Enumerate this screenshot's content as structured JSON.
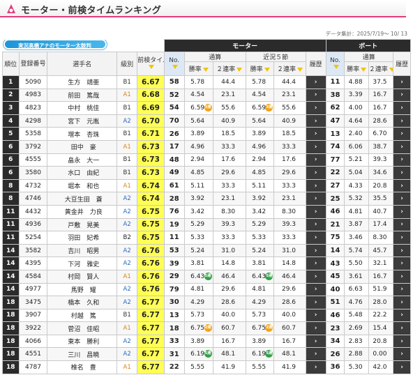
{
  "header": {
    "title": "モーター・前検タイムランキング",
    "logo_icon": "boat-race-logo-icon"
  },
  "period": "データ集計：2025/7/19～ 10/ 13",
  "banner": {
    "text": "実況高橋アナのモーター太鼓判"
  },
  "columns": {
    "rank": "順位",
    "reg": "登録番号",
    "name": "選手名",
    "class": "級別",
    "time": "前検タイム",
    "motor_group": "モーター",
    "boat_group": "ボート",
    "no": "No.",
    "overall": "通算",
    "recent": "近況５節",
    "win": "勝率",
    "rate2": "２連率",
    "history": "履歴"
  },
  "rows": [
    {
      "rank": "1",
      "reg": "5090",
      "name": "生方　靖亜",
      "cls": "B1",
      "time": "6.67",
      "m_no": "58",
      "m_win": "5.78",
      "m_r2": "44.4",
      "m_rw": "5.78",
      "m_rr2": "44.4",
      "b_no": "11",
      "b_win": "4.88",
      "b_r2": "37.5"
    },
    {
      "rank": "2",
      "reg": "4983",
      "name": "前田　篤哉",
      "cls": "A1",
      "time": "6.68",
      "m_no": "52",
      "m_win": "4.54",
      "m_r2": "23.1",
      "m_rw": "4.54",
      "m_rr2": "23.1",
      "b_no": "38",
      "b_win": "3.39",
      "b_r2": "16.7"
    },
    {
      "rank": "3",
      "reg": "4823",
      "name": "中村　桃佳",
      "cls": "B1",
      "time": "6.69",
      "m_no": "54",
      "m_win": "6.59",
      "m_r2": "55.6",
      "m_rw": "6.59",
      "m_rr2": "55.6",
      "b_no": "62",
      "b_win": "4.00",
      "b_r2": "16.7",
      "badge": "3d"
    },
    {
      "rank": "4",
      "reg": "4298",
      "name": "宮下　元胤",
      "cls": "A2",
      "time": "6.70",
      "m_no": "70",
      "m_win": "5.64",
      "m_r2": "40.9",
      "m_rw": "5.64",
      "m_rr2": "40.9",
      "b_no": "47",
      "b_win": "4.64",
      "b_r2": "28.6"
    },
    {
      "rank": "5",
      "reg": "5358",
      "name": "増本　杏珠",
      "cls": "B1",
      "time": "6.71",
      "m_no": "26",
      "m_win": "3.89",
      "m_r2": "18.5",
      "m_rw": "3.89",
      "m_rr2": "18.5",
      "b_no": "13",
      "b_win": "2.40",
      "b_r2": "6.70"
    },
    {
      "rank": "6",
      "reg": "3792",
      "name": "田中　豪",
      "cls": "A1",
      "time": "6.73",
      "m_no": "17",
      "m_win": "4.96",
      "m_r2": "33.3",
      "m_rw": "4.96",
      "m_rr2": "33.3",
      "b_no": "74",
      "b_win": "6.06",
      "b_r2": "38.7"
    },
    {
      "rank": "6",
      "reg": "4555",
      "name": "畠永　大一",
      "cls": "B1",
      "time": "6.73",
      "m_no": "48",
      "m_win": "2.94",
      "m_r2": "17.6",
      "m_rw": "2.94",
      "m_rr2": "17.6",
      "b_no": "77",
      "b_win": "5.21",
      "b_r2": "39.3"
    },
    {
      "rank": "6",
      "reg": "3580",
      "name": "水口　由紀",
      "cls": "B1",
      "time": "6.73",
      "m_no": "49",
      "m_win": "4.85",
      "m_r2": "29.6",
      "m_rw": "4.85",
      "m_rr2": "29.6",
      "b_no": "22",
      "b_win": "5.04",
      "b_r2": "34.6"
    },
    {
      "rank": "8",
      "reg": "4732",
      "name": "堀本　和也",
      "cls": "A1",
      "time": "6.74",
      "m_no": "61",
      "m_win": "5.11",
      "m_r2": "33.3",
      "m_rw": "5.11",
      "m_rr2": "33.3",
      "b_no": "27",
      "b_win": "4.33",
      "b_r2": "20.8"
    },
    {
      "rank": "8",
      "reg": "4746",
      "name": "大豆生田　蒼",
      "cls": "A2",
      "time": "6.74",
      "m_no": "28",
      "m_win": "3.92",
      "m_r2": "23.1",
      "m_rw": "3.92",
      "m_rr2": "23.1",
      "b_no": "25",
      "b_win": "5.32",
      "b_r2": "35.5"
    },
    {
      "rank": "11",
      "reg": "4432",
      "name": "黄金井　力良",
      "cls": "A2",
      "time": "6.75",
      "m_no": "76",
      "m_win": "3.42",
      "m_r2": "8.30",
      "m_rw": "3.42",
      "m_rr2": "8.30",
      "b_no": "46",
      "b_win": "4.81",
      "b_r2": "40.7"
    },
    {
      "rank": "11",
      "reg": "4936",
      "name": "戸敷　晃美",
      "cls": "A2",
      "time": "6.75",
      "m_no": "19",
      "m_win": "5.29",
      "m_r2": "39.3",
      "m_rw": "5.29",
      "m_rr2": "39.3",
      "b_no": "21",
      "b_win": "3.87",
      "b_r2": "17.4"
    },
    {
      "rank": "11",
      "reg": "5254",
      "name": "羽田　妃希",
      "cls": "B2",
      "time": "6.75",
      "m_no": "11",
      "m_win": "5.33",
      "m_r2": "33.3",
      "m_rw": "5.33",
      "m_rr2": "33.3",
      "b_no": "75",
      "b_win": "3.46",
      "b_r2": "8.30"
    },
    {
      "rank": "14",
      "reg": "3582",
      "name": "吉川　昭男",
      "cls": "A2",
      "time": "6.76",
      "m_no": "53",
      "m_win": "5.24",
      "m_r2": "31.0",
      "m_rw": "5.24",
      "m_rr2": "31.0",
      "b_no": "14",
      "b_win": "5.74",
      "b_r2": "45.7"
    },
    {
      "rank": "14",
      "reg": "4395",
      "name": "下河　雅史",
      "cls": "A2",
      "time": "6.76",
      "m_no": "39",
      "m_win": "3.81",
      "m_r2": "14.8",
      "m_rw": "3.81",
      "m_rr2": "14.8",
      "b_no": "43",
      "b_win": "5.50",
      "b_r2": "32.1"
    },
    {
      "rank": "14",
      "reg": "4584",
      "name": "村岡　賢人",
      "cls": "A1",
      "time": "6.76",
      "m_no": "29",
      "m_win": "6.43",
      "m_r2": "46.4",
      "m_rw": "6.43",
      "m_rr2": "46.4",
      "b_no": "45",
      "b_win": "3.61",
      "b_r2": "16.7",
      "badge": "5g"
    },
    {
      "rank": "14",
      "reg": "4977",
      "name": "馬野　耀",
      "cls": "A2",
      "time": "6.76",
      "m_no": "79",
      "m_win": "4.81",
      "m_r2": "29.6",
      "m_rw": "4.81",
      "m_rr2": "29.6",
      "b_no": "40",
      "b_win": "6.63",
      "b_r2": "51.9"
    },
    {
      "rank": "18",
      "reg": "3475",
      "name": "橋本　久和",
      "cls": "A2",
      "time": "6.77",
      "m_no": "30",
      "m_win": "4.29",
      "m_r2": "28.6",
      "m_rw": "4.29",
      "m_rr2": "28.6",
      "b_no": "51",
      "b_win": "4.76",
      "b_r2": "28.0"
    },
    {
      "rank": "18",
      "reg": "3907",
      "name": "村越　篤",
      "cls": "B1",
      "time": "6.77",
      "m_no": "13",
      "m_win": "5.73",
      "m_r2": "40.0",
      "m_rw": "5.73",
      "m_rr2": "40.0",
      "b_no": "46",
      "b_win": "5.48",
      "b_r2": "22.2"
    },
    {
      "rank": "18",
      "reg": "3922",
      "name": "菅沼　佳昭",
      "cls": "A1",
      "time": "6.77",
      "m_no": "18",
      "m_win": "6.75",
      "m_r2": "60.7",
      "m_rw": "6.75",
      "m_rr2": "60.7",
      "b_no": "23",
      "b_win": "2.69",
      "b_r2": "15.4",
      "badge": "2o"
    },
    {
      "rank": "18",
      "reg": "4066",
      "name": "東本　勝利",
      "cls": "A2",
      "time": "6.77",
      "m_no": "33",
      "m_win": "3.89",
      "m_r2": "16.7",
      "m_rw": "3.89",
      "m_rr2": "16.7",
      "b_no": "34",
      "b_win": "2.83",
      "b_r2": "20.8"
    },
    {
      "rank": "18",
      "reg": "4551",
      "name": "三川　昌暁",
      "cls": "A2",
      "time": "6.77",
      "m_no": "31",
      "m_win": "6.19",
      "m_r2": "48.1",
      "m_rw": "6.19",
      "m_rr2": "48.1",
      "b_no": "26",
      "b_win": "2.88",
      "b_r2": "0.00",
      "badge": "5g"
    },
    {
      "rank": "18",
      "reg": "4787",
      "name": "椎名　豊",
      "cls": "A1",
      "time": "6.77",
      "m_no": "22",
      "m_win": "5.55",
      "m_r2": "41.9",
      "m_rw": "5.55",
      "m_rr2": "41.9",
      "b_no": "36",
      "b_win": "5.30",
      "b_r2": "42.0"
    }
  ],
  "badges": {
    "3d": {
      "label": "3連",
      "color": "#f2a31b"
    },
    "5g": {
      "label": "5連",
      "color": "#33a04a"
    },
    "2o": {
      "label": "2連",
      "color": "#f2a31b"
    }
  },
  "history_arrow": "›"
}
